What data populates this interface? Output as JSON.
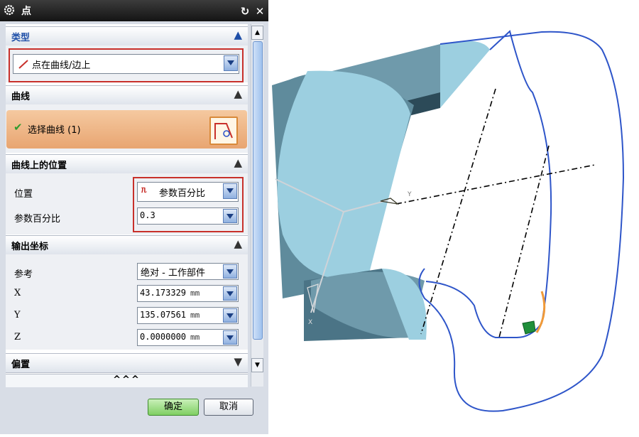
{
  "dialog": {
    "title": "点",
    "sections": {
      "type": {
        "label": "类型",
        "value": "点在曲线/边上"
      },
      "curve": {
        "label": "曲线",
        "select_label": "选择曲线 (1)"
      },
      "position": {
        "label": "曲线上的位置",
        "pos_label": "位置",
        "pos_value": "参数百分比",
        "pct_label": "参数百分比",
        "pct_value": "0.3"
      },
      "output": {
        "label": "输出坐标",
        "ref_label": "参考",
        "ref_value": "绝对 - 工作部件",
        "x_label": "X",
        "x_value": "43.173329",
        "x_unit": "mm",
        "y_label": "Y",
        "y_value": "135.07561",
        "y_unit": "mm",
        "z_label": "Z",
        "z_value": "0.0000000",
        "z_unit": "mm"
      },
      "offset": {
        "label": "偏置"
      }
    },
    "expand": "^^^",
    "ok_label": "确定",
    "cancel_label": "取消"
  },
  "colors": {
    "accent_red": "#c8302b",
    "curve_blue": "#2e55c9",
    "part_teal": "#9ccfe0"
  },
  "viewport": {
    "axis_y": "Y",
    "axis_x": "X"
  }
}
